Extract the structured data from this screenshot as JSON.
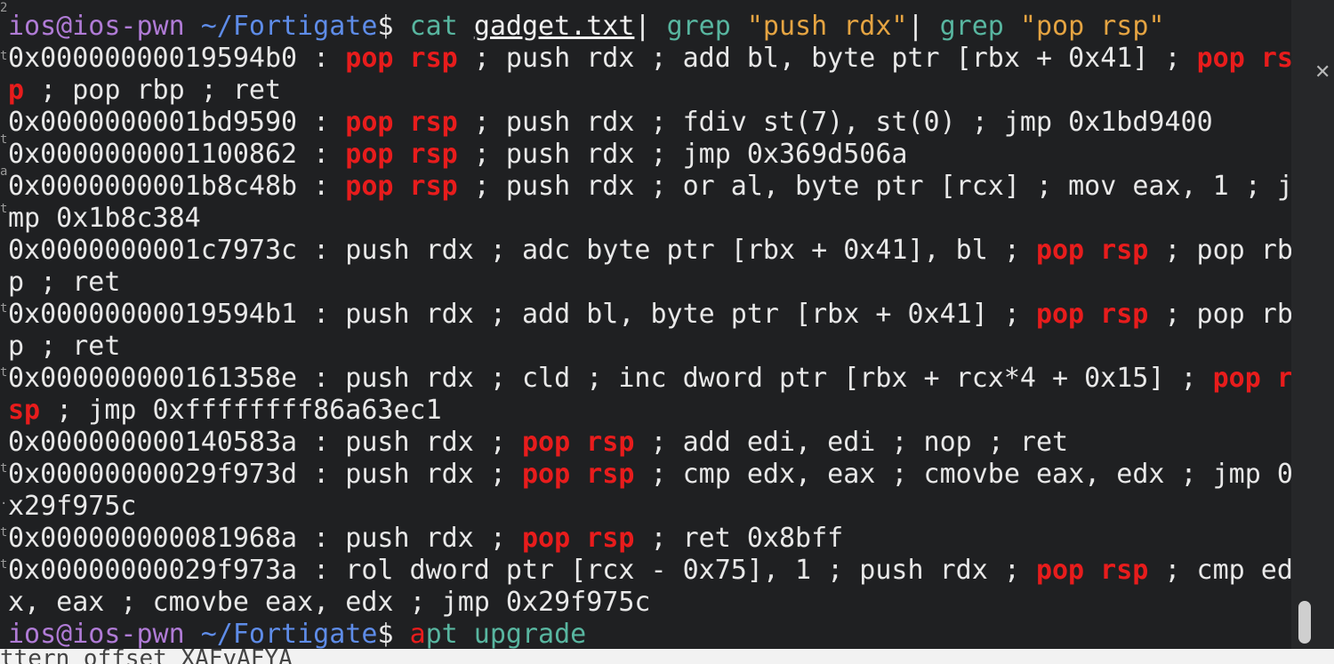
{
  "prompt": {
    "user": "ios@ios-pwn",
    "path": "~/Fortigate",
    "symbol": "$"
  },
  "command1": {
    "cmd": "cat",
    "file": "gadget.txt",
    "pipe1": "|",
    "grep1": "grep",
    "pattern1": "\"push rdx\"",
    "pipe2": "|",
    "grep2": "grep",
    "pattern2": "\"pop rsp\""
  },
  "output": [
    [
      "0x00000000019594b0 : ",
      {
        "hl": "pop rsp"
      },
      " ; push rdx ; add bl, byte ptr [rbx + 0x41] ; ",
      {
        "hl": "pop rs"
      }
    ],
    [
      {
        "hl": "p"
      },
      " ; pop rbp ; ret"
    ],
    [
      "0x0000000001bd9590 : ",
      {
        "hl": "pop rsp"
      },
      " ; push rdx ; fdiv st(7), st(0) ; jmp 0x1bd9400"
    ],
    [
      "0x0000000001100862 : ",
      {
        "hl": "pop rsp"
      },
      " ; push rdx ; jmp 0x369d506a"
    ],
    [
      "0x0000000001b8c48b : ",
      {
        "hl": "pop rsp"
      },
      " ; push rdx ; or al, byte ptr [rcx] ; mov eax, 1 ; j"
    ],
    [
      "mp 0x1b8c384"
    ],
    [
      "0x0000000001c7973c : push rdx ; adc byte ptr [rbx + 0x41], bl ; ",
      {
        "hl": "pop rsp"
      },
      " ; pop rb"
    ],
    [
      "p ; ret"
    ],
    [
      "0x00000000019594b1 : push rdx ; add bl, byte ptr [rbx + 0x41] ; ",
      {
        "hl": "pop rsp"
      },
      " ; pop rb"
    ],
    [
      "p ; ret"
    ],
    [
      "0x000000000161358e : push rdx ; cld ; inc dword ptr [rbx + rcx*4 + 0x15] ; ",
      {
        "hl": "pop r"
      }
    ],
    [
      {
        "hl": "sp"
      },
      " ; jmp 0xffffffff86a63ec1"
    ],
    [
      "0x000000000140583a : push rdx ; ",
      {
        "hl": "pop rsp"
      },
      " ; add edi, edi ; nop ; ret"
    ],
    [
      "0x00000000029f973d : push rdx ; ",
      {
        "hl": "pop rsp"
      },
      " ; cmp edx, eax ; cmovbe eax, edx ; jmp 0"
    ],
    [
      "x29f975c"
    ],
    [
      "0x000000000081968a : push rdx ; ",
      {
        "hl": "pop rsp"
      },
      " ; ret 0x8bff"
    ],
    [
      "0x00000000029f973a : rol dword ptr [rcx - 0x75], 1 ; push rdx ; ",
      {
        "hl": "pop rsp"
      },
      " ; cmp ed"
    ],
    [
      "x, eax ; cmovbe eax, edx ; jmp 0x29f975c"
    ]
  ],
  "command2": {
    "first": "a",
    "rest": "pt upgrade"
  },
  "behind_text": "ttern offset XAFvAFYA",
  "colors": {
    "highlight": "#e81c1c",
    "user": "#b07bd6",
    "path": "#5e8ce8",
    "command": "#58b6a0",
    "string": "#e5a442"
  },
  "icons": {
    "close": "close-icon"
  }
}
